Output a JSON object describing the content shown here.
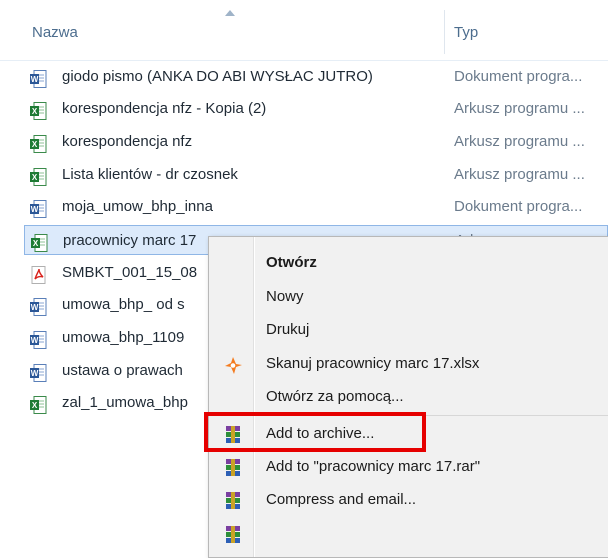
{
  "columns": {
    "name": "Nazwa",
    "type": "Typ"
  },
  "files": [
    {
      "name": "giodo pismo (ANKA DO ABI WYSŁAC JUTRO)",
      "type": "Dokument progra...",
      "icon": "word-doc-icon"
    },
    {
      "name": "korespondencja nfz - Kopia (2)",
      "type": "Arkusz programu ...",
      "icon": "excel-sheet-icon"
    },
    {
      "name": "korespondencja nfz",
      "type": "Arkusz programu ...",
      "icon": "excel-sheet-icon"
    },
    {
      "name": "Lista klientów - dr czosnek",
      "type": "Arkusz programu ...",
      "icon": "excel-sheet-icon"
    },
    {
      "name": "moja_umow_bhp_inna",
      "type": "Dokument progra...",
      "icon": "word-doc-icon"
    },
    {
      "name": "pracownicy marc 17",
      "type": "Arkusz programu ...",
      "icon": "excel-sheet-icon",
      "selected": true
    },
    {
      "name": "SMBKT_001_15_08",
      "type": "",
      "icon": "pdf-icon"
    },
    {
      "name": "umowa_bhp_ od s",
      "type": "",
      "icon": "word-doc-icon"
    },
    {
      "name": "umowa_bhp_1109",
      "type": "",
      "icon": "word-doc-icon"
    },
    {
      "name": "ustawa o prawach",
      "type": "",
      "icon": "word-doc-icon"
    },
    {
      "name": "zal_1_umowa_bhp",
      "type": "",
      "icon": "excel-sheet-icon"
    }
  ],
  "context_menu": {
    "open": "Otwórz",
    "new": "Nowy",
    "print": "Drukuj",
    "scan": "Skanuj pracownicy marc 17.xlsx",
    "open_with": "Otwórz za pomocą...",
    "add_to_archive": "Add to archive...",
    "add_to_rar": "Add to \"pracownicy marc 17.rar\"",
    "compress_email": "Compress and email..."
  },
  "colors": {
    "highlight": "#e60000",
    "selection": "#dceafb"
  }
}
